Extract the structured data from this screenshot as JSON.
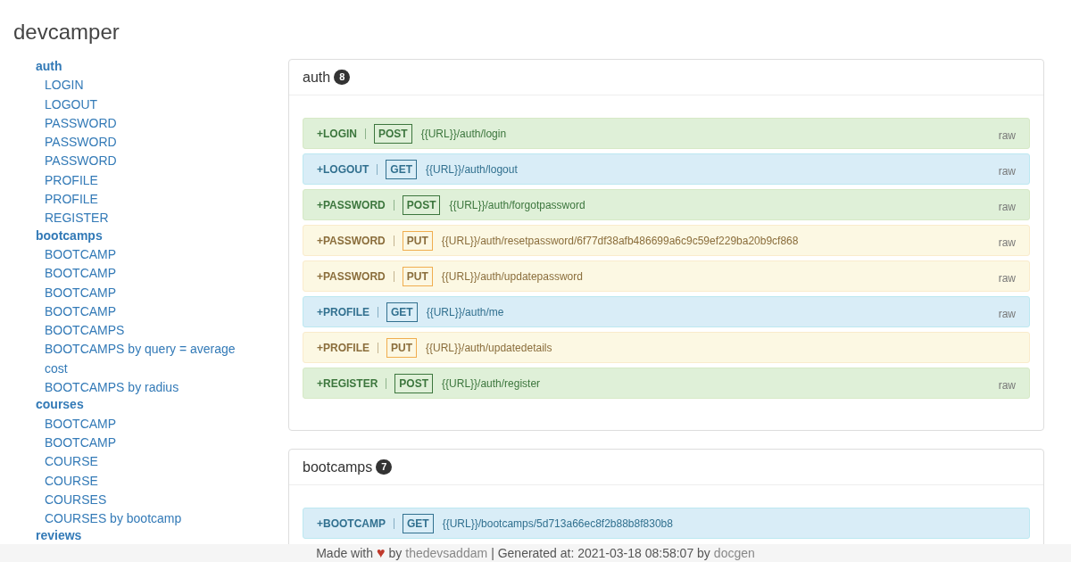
{
  "title": "devcamper",
  "sidebar": [
    {
      "group": "auth",
      "items": [
        "LOGIN",
        "LOGOUT",
        "PASSWORD",
        "PASSWORD",
        "PASSWORD",
        "PROFILE",
        "PROFILE",
        "REGISTER"
      ]
    },
    {
      "group": "bootcamps",
      "items": [
        "BOOTCAMP",
        "BOOTCAMP",
        "BOOTCAMP",
        "BOOTCAMP",
        "BOOTCAMPS",
        "BOOTCAMPS by query = average cost",
        "BOOTCAMPS by radius"
      ]
    },
    {
      "group": "courses",
      "items": [
        "BOOTCAMP",
        "BOOTCAMP",
        "COURSE",
        "COURSE",
        "COURSES",
        "COURSES by bootcamp"
      ]
    },
    {
      "group": "reviews"
    }
  ],
  "panels": [
    {
      "title": "auth",
      "count": "8",
      "endpoints": [
        {
          "name": "+LOGIN",
          "method": "POST",
          "url": "{{URL}}/auth/login",
          "raw": "raw"
        },
        {
          "name": "+LOGOUT",
          "method": "GET",
          "url": "{{URL}}/auth/logout",
          "raw": "raw"
        },
        {
          "name": "+PASSWORD",
          "method": "POST",
          "url": "{{URL}}/auth/forgotpassword",
          "raw": "raw"
        },
        {
          "name": "+PASSWORD",
          "method": "PUT",
          "url": "{{URL}}/auth/resetpassword/6f77df38afb486699a6c9c59ef229ba20b9cf868",
          "raw": "raw"
        },
        {
          "name": "+PASSWORD",
          "method": "PUT",
          "url": "{{URL}}/auth/updatepassword",
          "raw": "raw"
        },
        {
          "name": "+PROFILE",
          "method": "GET",
          "url": "{{URL}}/auth/me",
          "raw": "raw"
        },
        {
          "name": "+PROFILE",
          "method": "PUT",
          "url": "{{URL}}/auth/updatedetails"
        },
        {
          "name": "+REGISTER",
          "method": "POST",
          "url": "{{URL}}/auth/register",
          "raw": "raw"
        }
      ]
    },
    {
      "title": "bootcamps",
      "count": "7",
      "endpoints": [
        {
          "name": "+BOOTCAMP",
          "method": "GET",
          "url": "{{URL}}/bootcamps/5d713a66ec8f2b88b8f830b8"
        }
      ]
    }
  ],
  "footer": {
    "made_with": "Made with",
    "heart": "♥",
    "by1": "by",
    "author": "thedevsaddam",
    "generated": "| Generated at: 2021-03-18 08:58:07 by",
    "tool": "docgen"
  }
}
